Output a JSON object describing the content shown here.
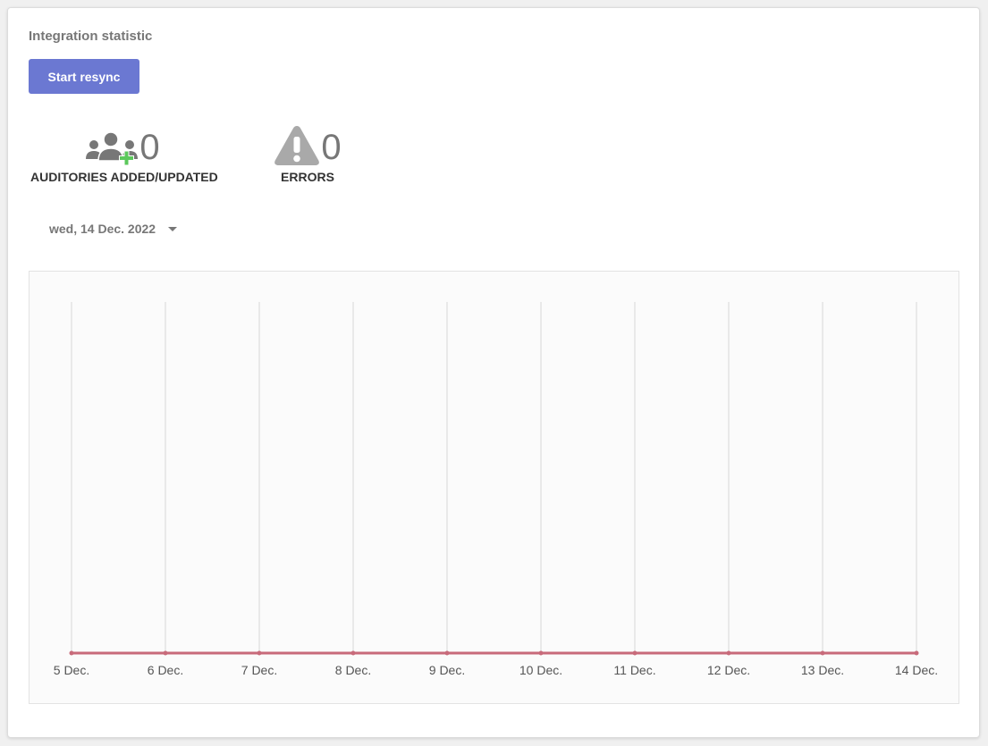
{
  "panel": {
    "title": "Integration statistic",
    "resync_button_label": "Start resync"
  },
  "stats": {
    "auditories": {
      "value": "0",
      "label": "AUDITORIES ADDED/UPDATED",
      "icon": "users-add-icon"
    },
    "errors": {
      "value": "0",
      "label": "ERRORS",
      "icon": "warning-icon"
    }
  },
  "date_filter": {
    "selected": "wed, 14 Dec. 2022"
  },
  "colors": {
    "accent": "#6b78d2",
    "series_line": "#c86a7a",
    "plus_green": "#5cc85c",
    "icon_gray": "#777777"
  },
  "chart_data": {
    "type": "line",
    "categories": [
      "5 Dec.",
      "6 Dec.",
      "7 Dec.",
      "8 Dec.",
      "9 Dec.",
      "10 Dec.",
      "11 Dec.",
      "12 Dec.",
      "13 Dec.",
      "14 Dec."
    ],
    "series": [
      {
        "values": [
          0,
          0,
          0,
          0,
          0,
          0,
          0,
          0,
          0,
          0
        ]
      }
    ],
    "title": "",
    "xlabel": "",
    "ylabel": "",
    "grid": "vertical"
  }
}
